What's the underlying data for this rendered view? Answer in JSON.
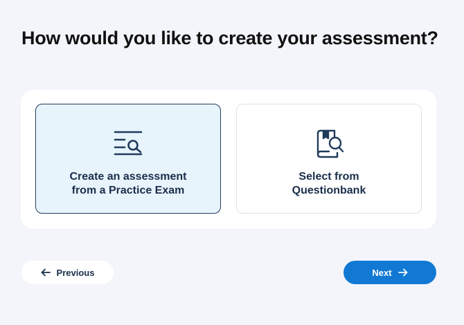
{
  "page": {
    "title": "How would you like to create your assessment?"
  },
  "options": [
    {
      "label_line1": "Create an assessment",
      "label_line2": "from a Practice Exam",
      "icon": "list-search-icon",
      "selected": true
    },
    {
      "label_line1": "Select from",
      "label_line2": "Questionbank",
      "icon": "book-search-icon",
      "selected": false
    }
  ],
  "navigation": {
    "previous_label": "Previous",
    "next_label": "Next"
  },
  "colors": {
    "background": "#f3f5fa",
    "panel": "#ffffff",
    "selected_card_bg": "#e8f4fc",
    "selected_card_border": "#1f3a5a",
    "text_dark": "#1a2e4a",
    "primary_button": "#1179d4"
  }
}
